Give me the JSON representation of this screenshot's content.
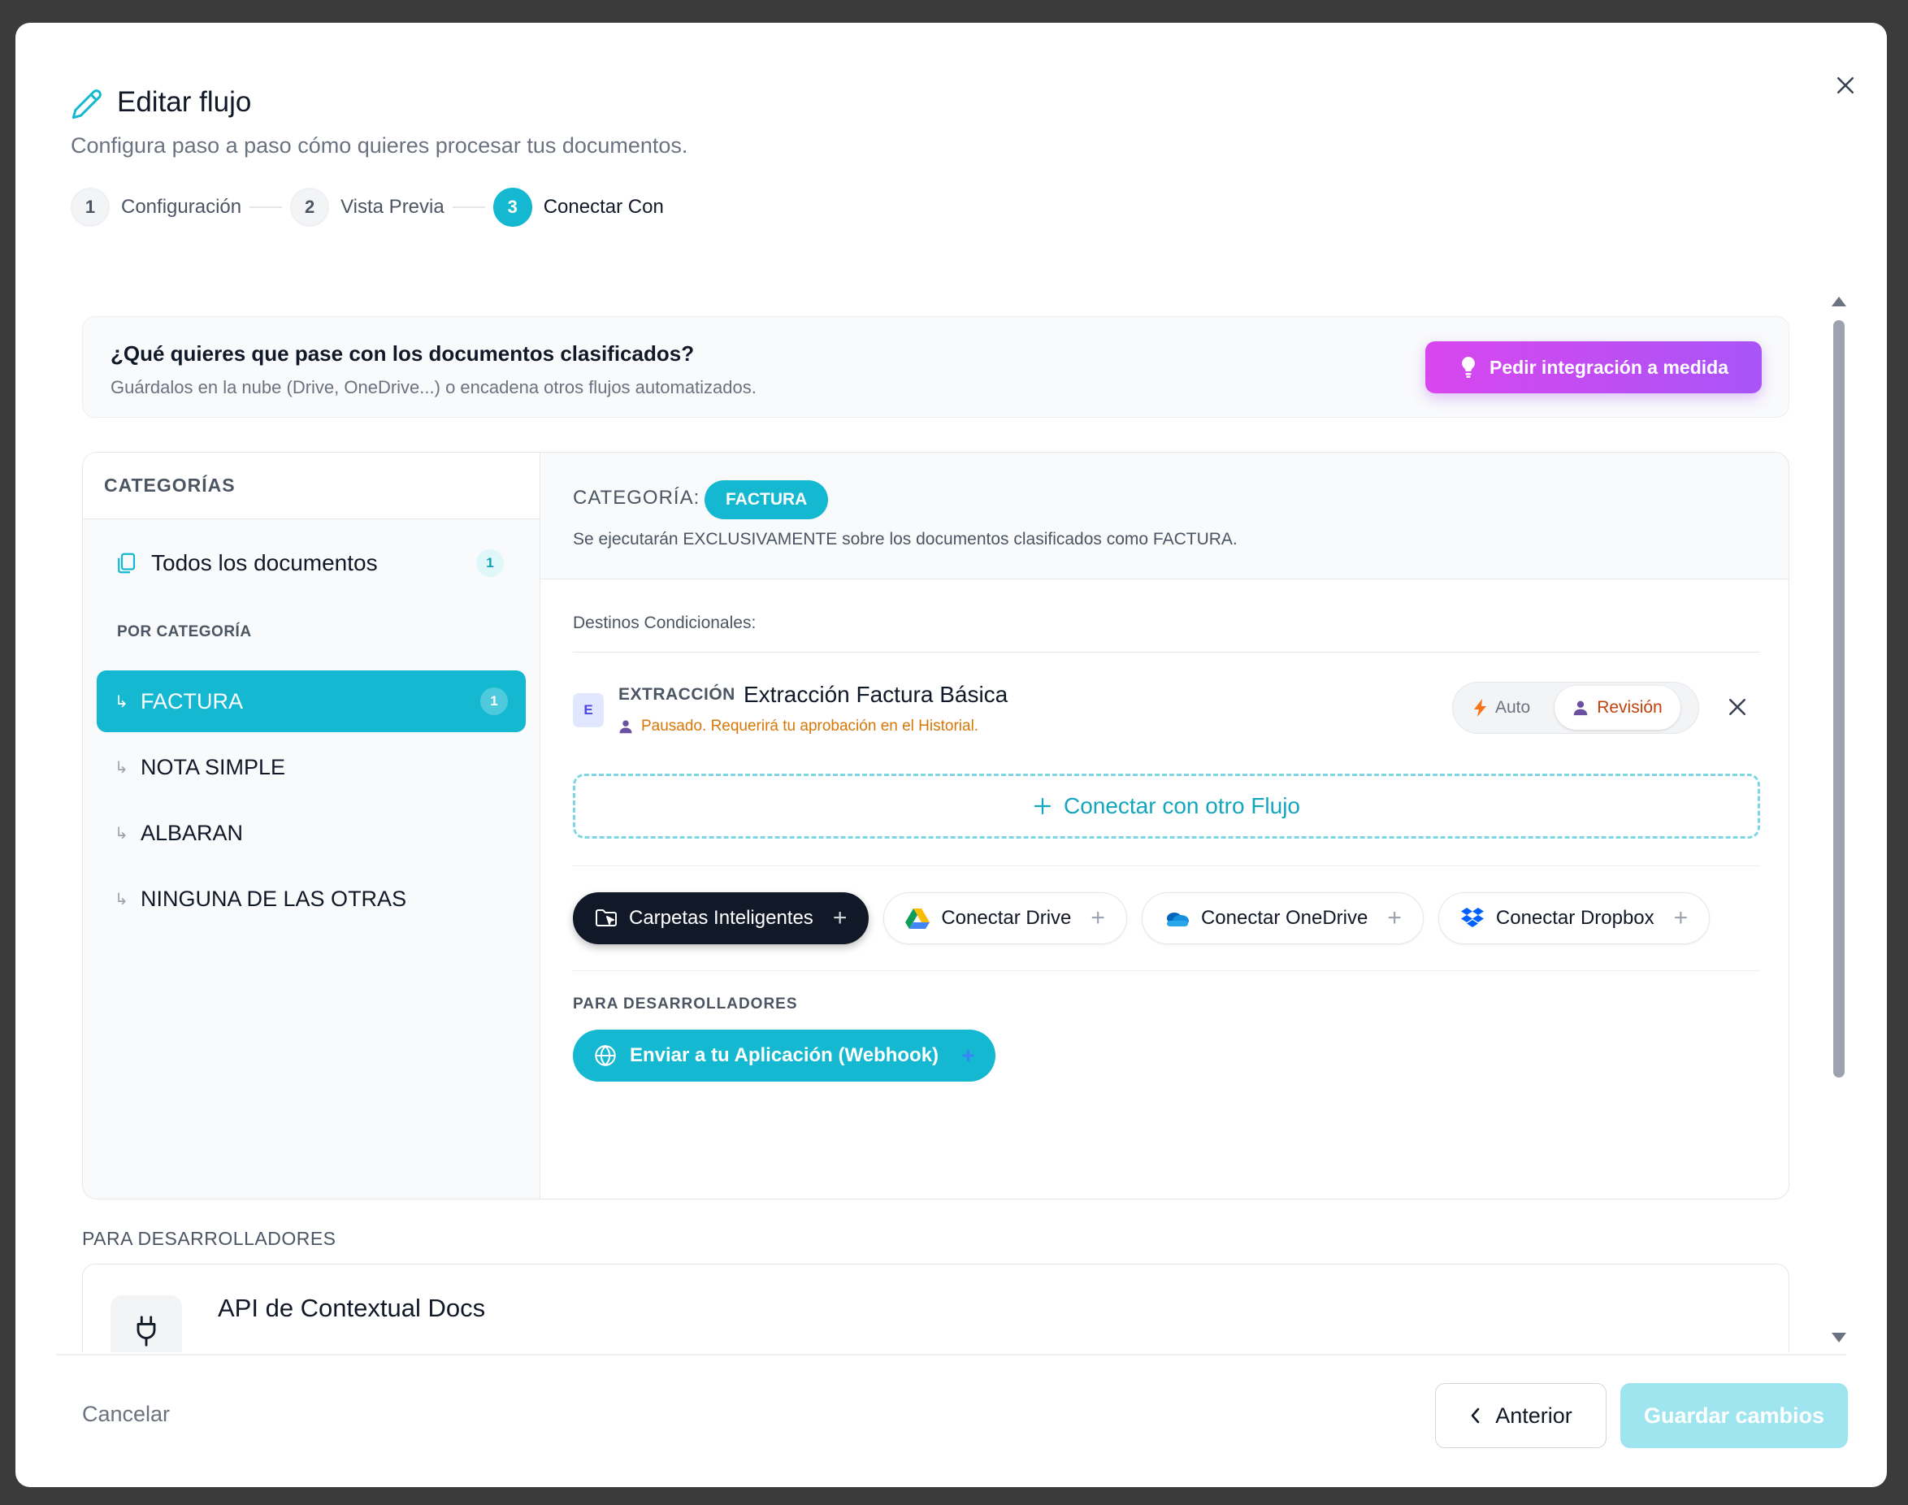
{
  "header": {
    "title": "Editar flujo",
    "subtitle": "Configura paso a paso cómo quieres procesar tus documentos."
  },
  "stepper": [
    {
      "num": "1",
      "label": "Configuración"
    },
    {
      "num": "2",
      "label": "Vista Previa"
    },
    {
      "num": "3",
      "label": "Conectar Con"
    }
  ],
  "banner": {
    "title": "¿Qué quieres que pase con los documentos clasificados?",
    "subtitle": "Guárdalos en la nube (Drive, OneDrive...) o encadena otros flujos automatizados.",
    "request_button": "Pedir integración a medida"
  },
  "sidebar": {
    "heading": "CATEGORÍAS",
    "all_docs": {
      "label": "Todos los documentos",
      "count": "1"
    },
    "section_label": "POR CATEGORÍA",
    "items": [
      {
        "label": "FACTURA",
        "count": "1",
        "active": true
      },
      {
        "label": "NOTA SIMPLE"
      },
      {
        "label": "ALBARAN"
      },
      {
        "label": "NINGUNA DE LAS OTRAS"
      }
    ]
  },
  "main": {
    "category_label": "CATEGORÍA:",
    "category_value": "FACTURA",
    "category_desc": "Se ejecutarán EXCLUSIVAMENTE sobre los documentos clasificados como FACTURA.",
    "destinations_title": "Destinos Condicionales:",
    "flow": {
      "badge": "E",
      "type": "EXTRACCIÓN",
      "name": "Extracción Factura Básica",
      "status": "Pausado. Requerirá tu aprobación en el Historial.",
      "mode_auto": "Auto",
      "mode_review": "Revisión"
    },
    "connect_flow_label": "Conectar con otro Flujo",
    "integrations": [
      {
        "label": "Carpetas Inteligentes",
        "icon": "smart-folder-icon"
      },
      {
        "label": "Conectar Drive",
        "icon": "google-drive-icon"
      },
      {
        "label": "Conectar OneDrive",
        "icon": "onedrive-icon"
      },
      {
        "label": "Conectar Dropbox",
        "icon": "dropbox-icon"
      }
    ],
    "developers_label": "PARA DESARROLLADORES",
    "webhook_label": "Enviar a tu Aplicación (Webhook)"
  },
  "developers": {
    "heading": "PARA DESARROLLADORES",
    "api_title": "API de Contextual Docs"
  },
  "footer": {
    "cancel": "Cancelar",
    "previous": "Anterior",
    "save": "Guardar cambios"
  },
  "colors": {
    "accent": "#14b8d0",
    "magenta": "#d946ef",
    "warning": "#d97706"
  }
}
